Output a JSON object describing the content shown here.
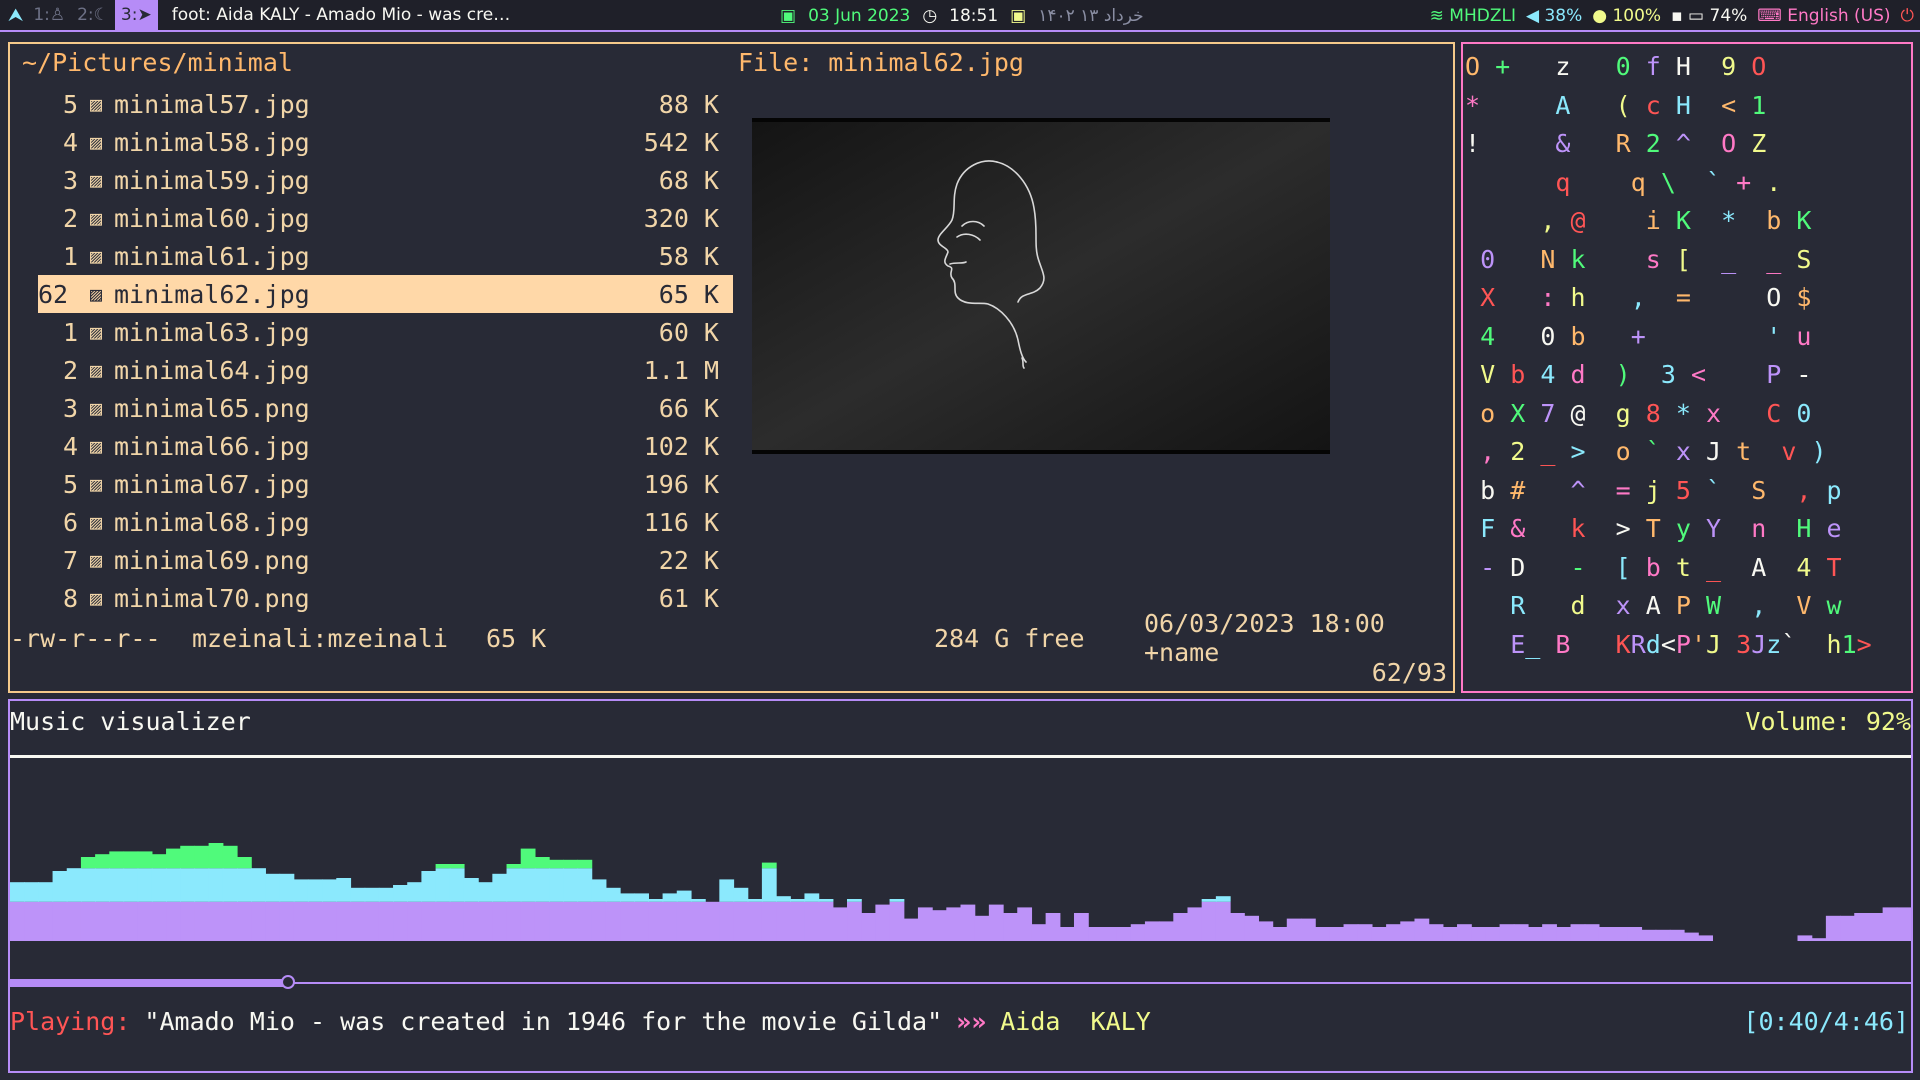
{
  "topbar": {
    "workspaces": [
      {
        "label": "1:",
        "icon": "person-icon",
        "glyph": "♙",
        "active": false
      },
      {
        "label": "2:",
        "icon": "moon-icon",
        "glyph": "☾",
        "active": false
      },
      {
        "label": "3:",
        "icon": "telegram-icon",
        "glyph": "➤",
        "active": true
      }
    ],
    "window_title": "foot: Aida  KALY - Amado Mio - was cre…",
    "date": "03 Jun 2023",
    "time": "18:51",
    "jalali_date": "۱۴۰۲ خرداد ۱۳",
    "wifi": "MHDZLI",
    "volume": "38%",
    "brightness": "100%",
    "battery": "74%",
    "keyboard_layout": "English (US)"
  },
  "file_manager": {
    "path": "~/Pictures/minimal",
    "preview_title": "File: minimal62.jpg",
    "files": [
      {
        "num": "5",
        "name": "minimal57.jpg",
        "size": "88 K",
        "selected": false
      },
      {
        "num": "4",
        "name": "minimal58.jpg",
        "size": "542 K",
        "selected": false
      },
      {
        "num": "3",
        "name": "minimal59.jpg",
        "size": "68 K",
        "selected": false
      },
      {
        "num": "2",
        "name": "minimal60.jpg",
        "size": "320 K",
        "selected": false
      },
      {
        "num": "1",
        "name": "minimal61.jpg",
        "size": "58 K",
        "selected": false
      },
      {
        "num": "62",
        "name": "minimal62.jpg",
        "size": "65 K",
        "selected": true
      },
      {
        "num": "1",
        "name": "minimal63.jpg",
        "size": "60 K",
        "selected": false
      },
      {
        "num": "2",
        "name": "minimal64.jpg",
        "size": "1.1 M",
        "selected": false
      },
      {
        "num": "3",
        "name": "minimal65.png",
        "size": "66 K",
        "selected": false
      },
      {
        "num": "4",
        "name": "minimal66.jpg",
        "size": "102 K",
        "selected": false
      },
      {
        "num": "5",
        "name": "minimal67.jpg",
        "size": "196 K",
        "selected": false
      },
      {
        "num": "6",
        "name": "minimal68.jpg",
        "size": "116 K",
        "selected": false
      },
      {
        "num": "7",
        "name": "minimal69.png",
        "size": "22 K",
        "selected": false
      },
      {
        "num": "8",
        "name": "minimal70.png",
        "size": "61 K",
        "selected": false
      }
    ],
    "status": {
      "permissions": "-rw-r--r--",
      "owner": "mzeinali:mzeinali",
      "size": "65 K",
      "free": "284 G free",
      "mtime": "06/03/2023 18:00 +name",
      "counter": "62/93"
    }
  },
  "matrix": {
    "rows": [
      "O +   z   0 f H  9 O",
      "*     A   ( c H  < 1",
      "!     &   R 2 ^  O Z",
      "      q    q \\  ` + .",
      "     , @    i K  *  b K",
      " 0   N k    s [  _  _ S",
      " X   : h   ,  =     O $",
      " 4   0 b   +        ' u",
      " V b 4 d  )  3 <    P -",
      " o X 7 @  g 8 * x   C 0",
      " , 2 _ >  o ` x J t  v )",
      " b #   ^  = j 5 `  S  , p",
      " F &   k  > T y Y  n  H e",
      " - D   -  [ b t _  A  4 T",
      "   R   d  x A P W  ,  V w",
      "   E_ B   KRd<P'J 3Jz`  h1>"
    ],
    "palette": [
      "#ffb86c",
      "#8be9fd",
      "#50fa7b",
      "#ff79c6",
      "#bd93f9",
      "#f1fa8c",
      "#f8f8f2",
      "#ff5555"
    ]
  },
  "visualizer": {
    "title": "Music visualizer",
    "volume": "Volume: 92%",
    "bars": [
      0.42,
      0.42,
      0.42,
      0.5,
      0.52,
      0.6,
      0.62,
      0.64,
      0.64,
      0.64,
      0.62,
      0.66,
      0.68,
      0.68,
      0.7,
      0.68,
      0.6,
      0.52,
      0.48,
      0.48,
      0.44,
      0.44,
      0.44,
      0.45,
      0.38,
      0.38,
      0.38,
      0.4,
      0.42,
      0.5,
      0.55,
      0.55,
      0.45,
      0.42,
      0.48,
      0.55,
      0.66,
      0.6,
      0.58,
      0.58,
      0.58,
      0.44,
      0.38,
      0.34,
      0.34,
      0.3,
      0.34,
      0.36,
      0.3,
      0.28,
      0.44,
      0.38,
      0.3,
      0.56,
      0.32,
      0.3,
      0.34,
      0.3,
      0.24,
      0.3,
      0.2,
      0.26,
      0.3,
      0.16,
      0.24,
      0.22,
      0.24,
      0.26,
      0.18,
      0.26,
      0.2,
      0.24,
      0.12,
      0.2,
      0.1,
      0.2,
      0.1,
      0.1,
      0.1,
      0.12,
      0.14,
      0.14,
      0.2,
      0.24,
      0.3,
      0.32,
      0.2,
      0.18,
      0.14,
      0.1,
      0.16,
      0.16,
      0.1,
      0.1,
      0.12,
      0.12,
      0.1,
      0.12,
      0.14,
      0.16,
      0.12,
      0.1,
      0.12,
      0.1,
      0.1,
      0.12,
      0.12,
      0.1,
      0.12,
      0.1,
      0.12,
      0.12,
      0.1,
      0.1,
      0.1,
      0.08,
      0.08,
      0.08,
      0.06,
      0.04,
      0.0,
      0.0,
      0.0,
      0.0,
      0.0,
      0.0,
      0.04,
      0.02,
      0.18,
      0.18,
      0.2,
      0.2,
      0.24,
      0.24
    ],
    "colors": {
      "base": "#bd93f9",
      "low": "#8be9fd",
      "mid": "#50fa7b",
      "high": "#f1fa8c",
      "peak": "#ff79c6"
    },
    "progress": 0.146,
    "playing_label": "Playing:",
    "song": "\"Amado Mio - was created in 1946 for the movie Gilda\"",
    "arrow": "»»",
    "artist": "Aida  KALY",
    "time": "[0:40/4:46]"
  }
}
